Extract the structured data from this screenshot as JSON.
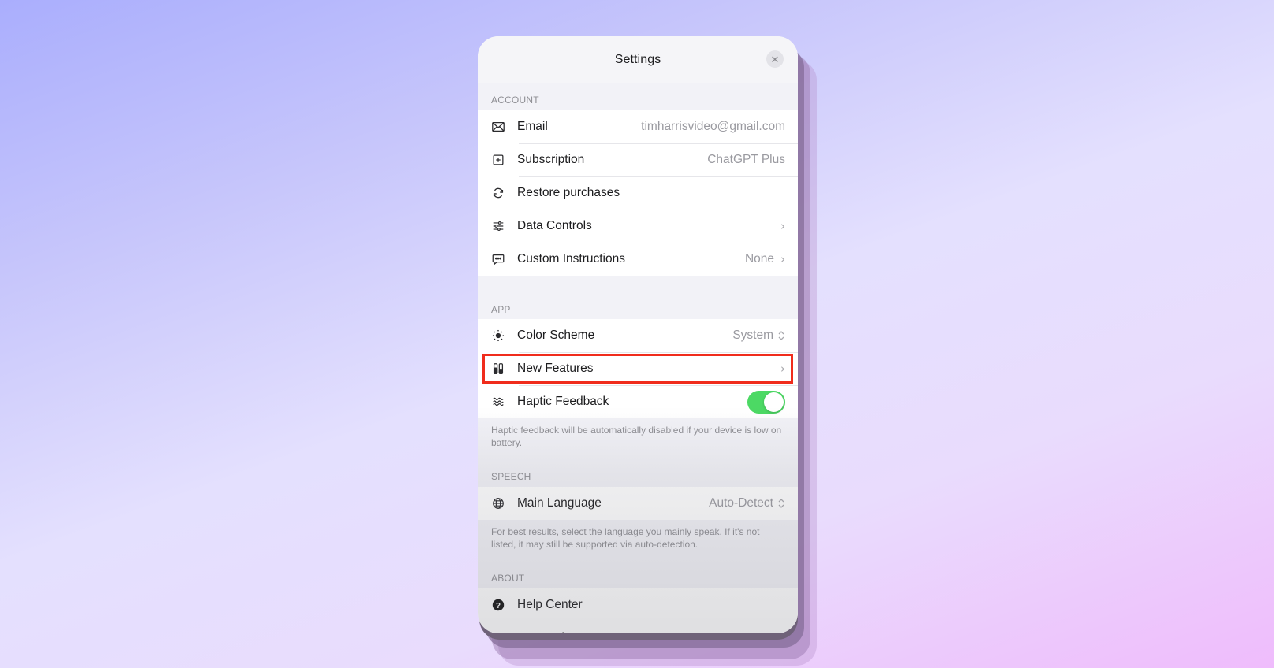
{
  "header": {
    "title": "Settings",
    "close_icon": "close-icon"
  },
  "sections": {
    "account": {
      "label": "ACCOUNT",
      "rows": [
        {
          "icon": "envelope-icon",
          "label": "Email",
          "value": "timharrisvideo@gmail.com"
        },
        {
          "icon": "plus-square-icon",
          "label": "Subscription",
          "value": "ChatGPT Plus"
        },
        {
          "icon": "refresh-icon",
          "label": "Restore purchases",
          "value": ""
        },
        {
          "icon": "sliders-icon",
          "label": "Data Controls",
          "value": "",
          "chevron": "›"
        },
        {
          "icon": "speech-bubble-icon",
          "label": "Custom Instructions",
          "value": "None",
          "chevron": "›"
        }
      ]
    },
    "app": {
      "label": "APP",
      "rows": [
        {
          "icon": "sun-icon",
          "label": "Color Scheme",
          "value": "System",
          "selector": "up-down"
        },
        {
          "icon": "test-tubes-icon",
          "label": "New Features",
          "value": "",
          "chevron": "›",
          "highlighted": true
        },
        {
          "icon": "waves-icon",
          "label": "Haptic Feedback",
          "toggle": true
        }
      ],
      "footnote": "Haptic feedback will be automatically disabled if your device is low on battery."
    },
    "speech": {
      "label": "SPEECH",
      "rows": [
        {
          "icon": "globe-icon",
          "label": "Main Language",
          "value": "Auto-Detect",
          "selector": "up-down"
        }
      ],
      "footnote": "For best results, select the language you mainly speak. If it's not listed, it may still be supported via auto-detection."
    },
    "about": {
      "label": "ABOUT",
      "rows": [
        {
          "icon": "question-circle-icon",
          "label": "Help Center"
        },
        {
          "icon": "document-icon",
          "label": "Terms of Use"
        }
      ]
    }
  },
  "colors": {
    "toggle_on": "#4cd964",
    "highlight_border": "#f02c1c"
  }
}
